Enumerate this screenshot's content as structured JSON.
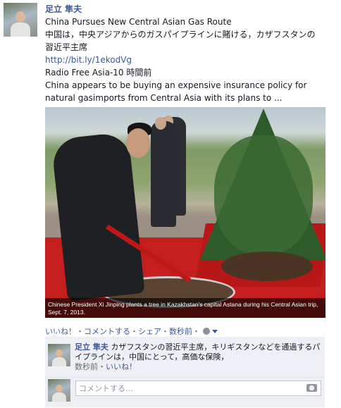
{
  "post": {
    "author": "足立 隼夫",
    "title": "China Pursues New Central Asian Gas Route",
    "japanese_text_line1": "中国は，中央アジアからのガスパイプラインに賭ける，カザフスタンの",
    "japanese_text_line2": "習近平主席",
    "link": "http://bit.ly/1ekodVg",
    "source_time": "Radio Free Asia-10 時間前",
    "summary": "China appears to be buying an expensive insurance policy for natural gasimports from Central Asia with its plans to ...",
    "photo_caption": "Chinese President Xi Jinping plants a tree in Kazakhstan's capital Astana during his Central Asian trip, Sept. 7, 2013."
  },
  "actions": {
    "like": "いいね！",
    "sep1": "・",
    "comment": "コメントする",
    "sep2": "・",
    "share": "シェア",
    "sep3": "・",
    "time": "数秒前",
    "sep4": "・"
  },
  "comment": {
    "author": "足立 隼夫",
    "text": "カザフスタンの習近平主席，キリギスタンなどを通過するパイプラインは，中国にとって，高価な保険，",
    "time": "数秒前",
    "sep": "・",
    "like": "いいね！"
  },
  "comment_input": {
    "placeholder": "コメントする..."
  },
  "icons": {
    "privacy": "globe-icon",
    "audience_dropdown": "chevron-down-icon",
    "camera": "camera-icon"
  },
  "colors": {
    "link": "#3b5998",
    "ufi_background": "#edeff4",
    "meta_text": "#6d6d6d"
  }
}
